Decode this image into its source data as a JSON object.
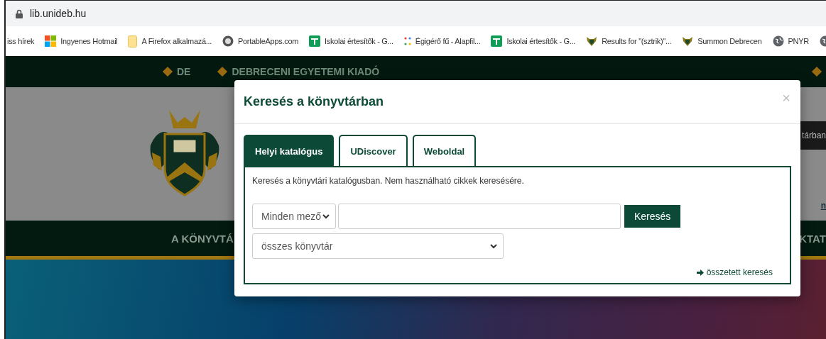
{
  "address_bar": {
    "url": "lib.unideb.hu"
  },
  "bookmarks": [
    {
      "kind": "none",
      "label": "iss hírek"
    },
    {
      "kind": "windows",
      "label": "Ingyenes Hotmail"
    },
    {
      "kind": "folder",
      "label": "A Firefox alkalmazá..."
    },
    {
      "kind": "portable",
      "label": "PortableApps.com"
    },
    {
      "kind": "classroom",
      "label": "Iskolai értesítők - G..."
    },
    {
      "kind": "dots",
      "label": "Égigérő fű - Alapfil..."
    },
    {
      "kind": "classroom",
      "label": "Iskolai értesítők - G..."
    },
    {
      "kind": "crest",
      "label": "Results for \"(sztrik)\"..."
    },
    {
      "kind": "crest",
      "label": "Summon Debrecen"
    },
    {
      "kind": "globe",
      "label": "PNYR"
    },
    {
      "kind": "globe"
    }
  ],
  "site": {
    "top_links": [
      "DE",
      "DEBRECENI EGYETEMI KIADÓ"
    ],
    "header_button": "tárban",
    "header_link": "n",
    "nav_left": "A KÖNYVTÁ",
    "nav_right": "KTAT"
  },
  "modal": {
    "title": "Keresés a könyvtárban",
    "close": "×",
    "tabs": [
      {
        "label": "Helyi katalógus",
        "selected": true
      },
      {
        "label": "UDiscover",
        "selected": false
      },
      {
        "label": "Weboldal",
        "selected": false
      }
    ],
    "description": "Keresés a könyvtári katalógusban. Nem használható cikkek keresésére.",
    "field_select": "Minden mező",
    "search_button": "Keresés",
    "library_select": "összes könyvtár",
    "advanced_link": "összetett keresés"
  }
}
